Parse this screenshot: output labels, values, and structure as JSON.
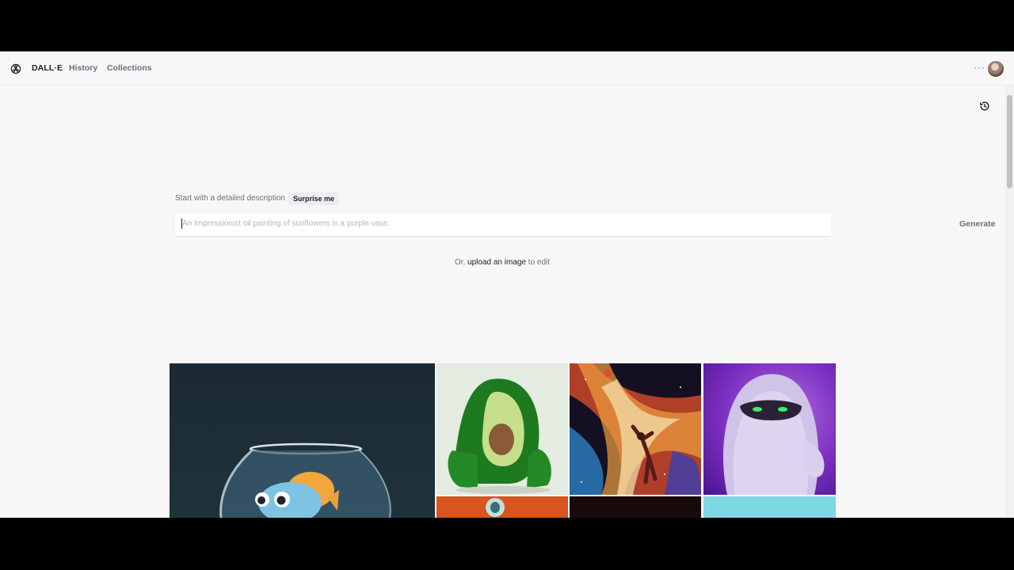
{
  "nav": {
    "brand": "DALL·E",
    "links": [
      "History",
      "Collections"
    ],
    "more_label": "···"
  },
  "prompt": {
    "label": "Start with a detailed description",
    "surprise_label": "Surprise me",
    "placeholder": "An Impressionist oil painting of sunflowers in a purple vase.",
    "value": "",
    "generate_label": "Generate"
  },
  "upload": {
    "prefix": "Or,",
    "link": "upload an image",
    "suffix": "to edit"
  },
  "icons": {
    "logo": "openai-logo-icon",
    "history": "history-icon",
    "more": "more-icon"
  },
  "gallery": {
    "tiles": [
      "fish-in-bowl",
      "avocado-armchair",
      "space-basketball",
      "purple-yeti",
      "orange-portrait",
      "dark-scene",
      "cyan-scene"
    ]
  }
}
